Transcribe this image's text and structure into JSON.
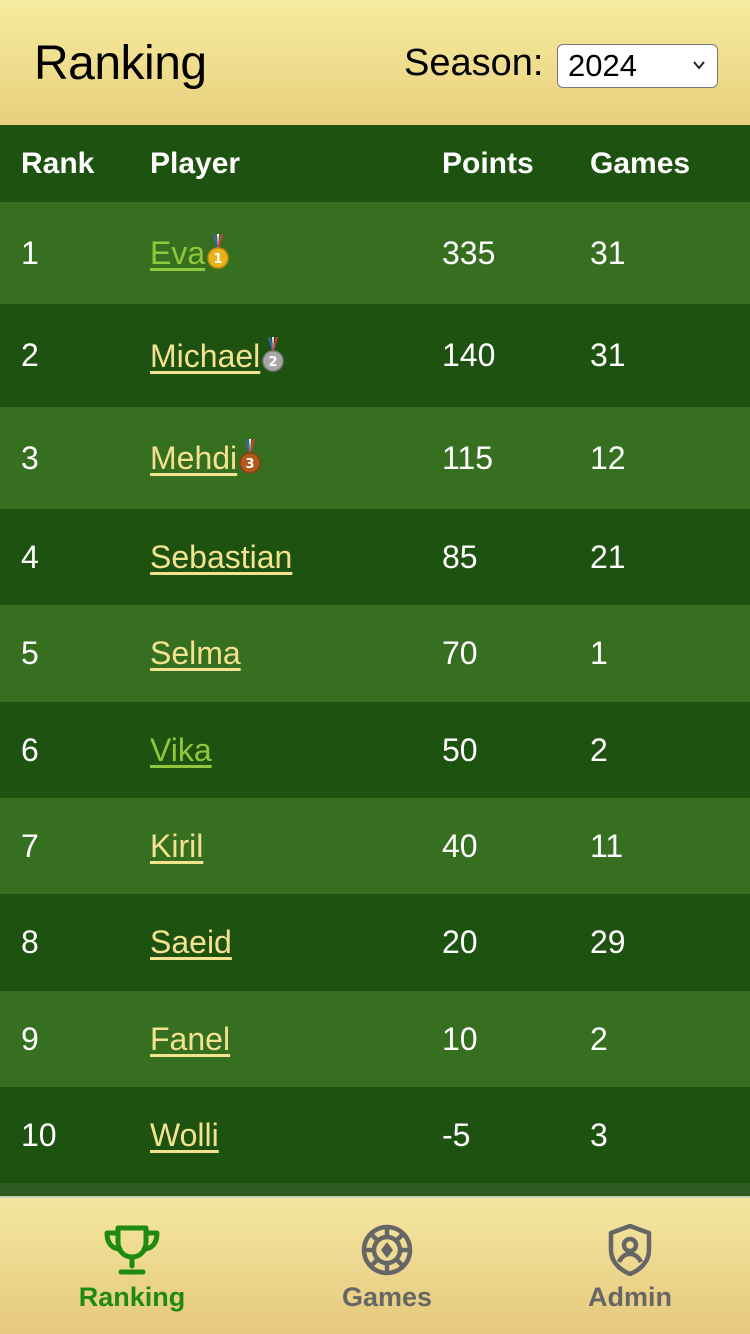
{
  "header": {
    "title": "Ranking",
    "season_label": "Season:",
    "season_value": "2024"
  },
  "table": {
    "columns": [
      "Rank",
      "Player",
      "Points",
      "Games"
    ],
    "rows": [
      {
        "rank": "1",
        "player": "Eva",
        "points": "335",
        "games": "31",
        "medal": "gold-medal-icon"
      },
      {
        "rank": "2",
        "player": "Michael",
        "points": "140",
        "games": "31",
        "medal": "silver-medal-icon"
      },
      {
        "rank": "3",
        "player": "Mehdi",
        "points": "115",
        "games": "12",
        "medal": "bronze-medal-icon"
      },
      {
        "rank": "4",
        "player": "Sebastian",
        "points": "85",
        "games": "21"
      },
      {
        "rank": "5",
        "player": "Selma",
        "points": "70",
        "games": "1"
      },
      {
        "rank": "6",
        "player": "Vika",
        "points": "50",
        "games": "2"
      },
      {
        "rank": "7",
        "player": "Kiril",
        "points": "40",
        "games": "11"
      },
      {
        "rank": "8",
        "player": "Saeid",
        "points": "20",
        "games": "29"
      },
      {
        "rank": "9",
        "player": "Fanel",
        "points": "10",
        "games": "2"
      },
      {
        "rank": "10",
        "player": "Wolli",
        "points": "-5",
        "games": "3"
      }
    ]
  },
  "tabbar": {
    "items": [
      {
        "label": "Ranking",
        "icon": "trophy-icon",
        "active": true
      },
      {
        "label": "Games",
        "icon": "poker-chip-icon",
        "active": false
      },
      {
        "label": "Admin",
        "icon": "shield-user-icon",
        "active": false
      }
    ]
  },
  "colors": {
    "header_bg": "#f6ec9f",
    "row_dark": "#1e5210",
    "row_light": "#366f20",
    "link": "#f3e28f",
    "link_visited": "#8fc63b",
    "tab_active": "#1e8a10",
    "tab_inactive": "#666666"
  }
}
